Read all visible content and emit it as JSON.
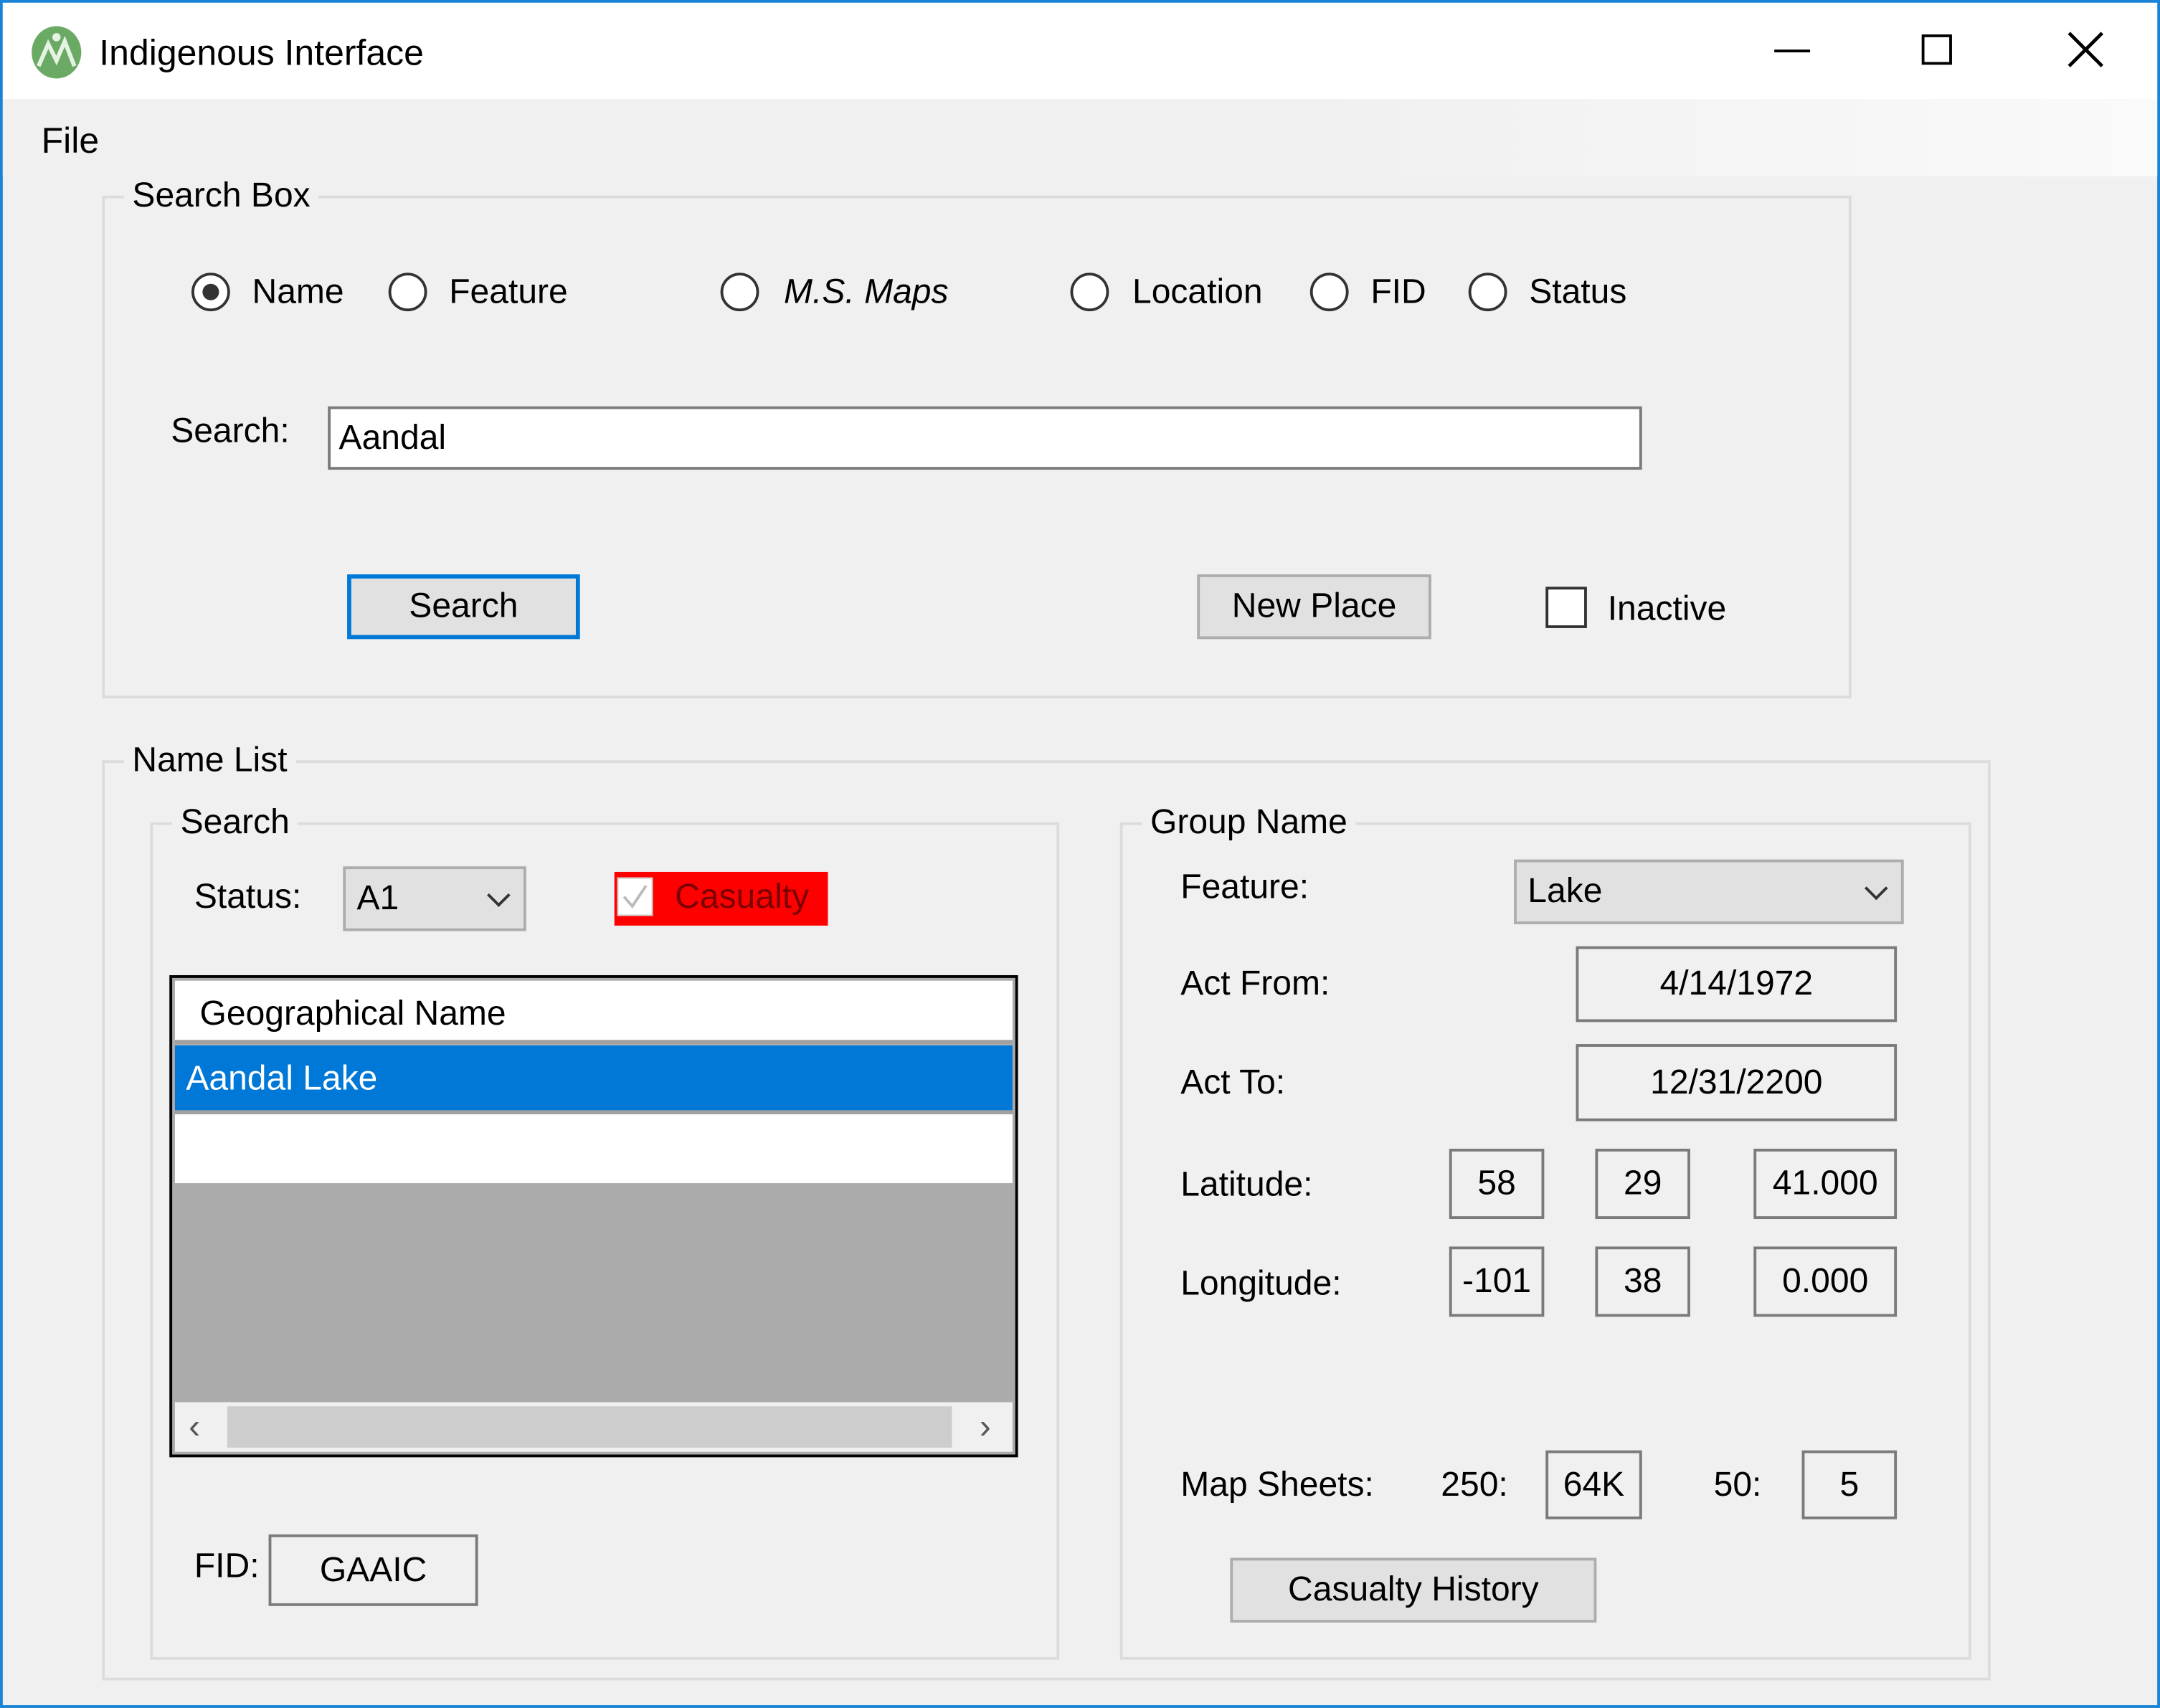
{
  "window": {
    "title": "Indigenous Interface",
    "icon": "app-globe-icon"
  },
  "menu": {
    "file": "File"
  },
  "search_box": {
    "label": "Search Box",
    "radios": [
      {
        "label": "Name",
        "selected": true
      },
      {
        "label": "Feature",
        "selected": false
      },
      {
        "label": "M.S. Maps",
        "selected": false
      },
      {
        "label": "Location",
        "selected": false
      },
      {
        "label": "FID",
        "selected": false
      },
      {
        "label": "Status",
        "selected": false
      }
    ],
    "search_label": "Search:",
    "search_value": "Aandal",
    "search_button": "Search",
    "new_place_button": "New Place",
    "inactive_label": "Inactive"
  },
  "name_list": {
    "label": "Name List",
    "search_group": {
      "label": "Search",
      "status_label": "Status:",
      "status_value": "A1",
      "casualty_label": "Casualty",
      "casualty_color": "#ff0000",
      "list_header": "Geographical Name",
      "rows": [
        "Aandal Lake"
      ],
      "fid_label": "FID:",
      "fid_value": "GAAIC"
    },
    "group_name": {
      "label": "Group Name",
      "feature_label": "Feature:",
      "feature_value": "Lake",
      "act_from_label": "Act From:",
      "act_from_value": "4/14/1972",
      "act_to_label": "Act To:",
      "act_to_value": "12/31/2200",
      "latitude_label": "Latitude:",
      "latitude": [
        "58",
        "29",
        "41.000"
      ],
      "longitude_label": "Longitude:",
      "longitude": [
        "-101",
        "38",
        "0.000"
      ],
      "map_sheets_label": "Map Sheets:",
      "sheet_250_label": "250:",
      "sheet_250_value": "64K",
      "sheet_50_label": "50:",
      "sheet_50_value": "5",
      "casualty_history_button": "Casualty History"
    }
  }
}
